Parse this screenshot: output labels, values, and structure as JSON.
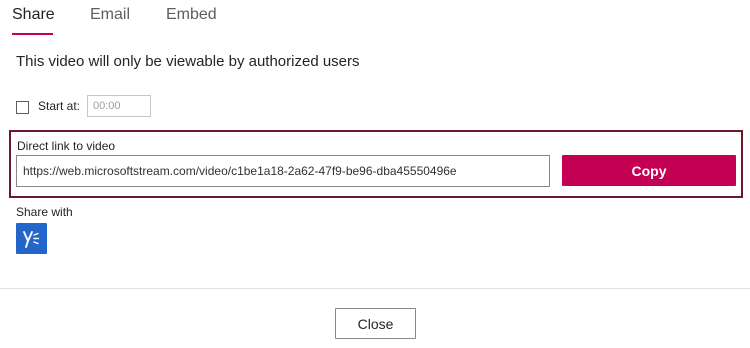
{
  "tabs": [
    {
      "label": "Share",
      "active": true
    },
    {
      "label": "Email",
      "active": false
    },
    {
      "label": "Embed",
      "active": false
    }
  ],
  "notice": "This video will only be viewable by authorized users",
  "start_at": {
    "label": "Start at:",
    "placeholder": "00:00",
    "checked": false
  },
  "direct_link": {
    "label": "Direct link to video",
    "value": "https://web.microsoftstream.com/video/c1be1a18-2a62-47f9-be96-dba45550496e",
    "copy_label": "Copy"
  },
  "share_with": {
    "label": "Share with",
    "services": [
      {
        "icon": "yammer-icon"
      }
    ]
  },
  "footer": {
    "close_label": "Close"
  },
  "colors": {
    "accent": "#c30052",
    "highlight_border": "#6b1a2a",
    "yammer": "#2266c9"
  }
}
